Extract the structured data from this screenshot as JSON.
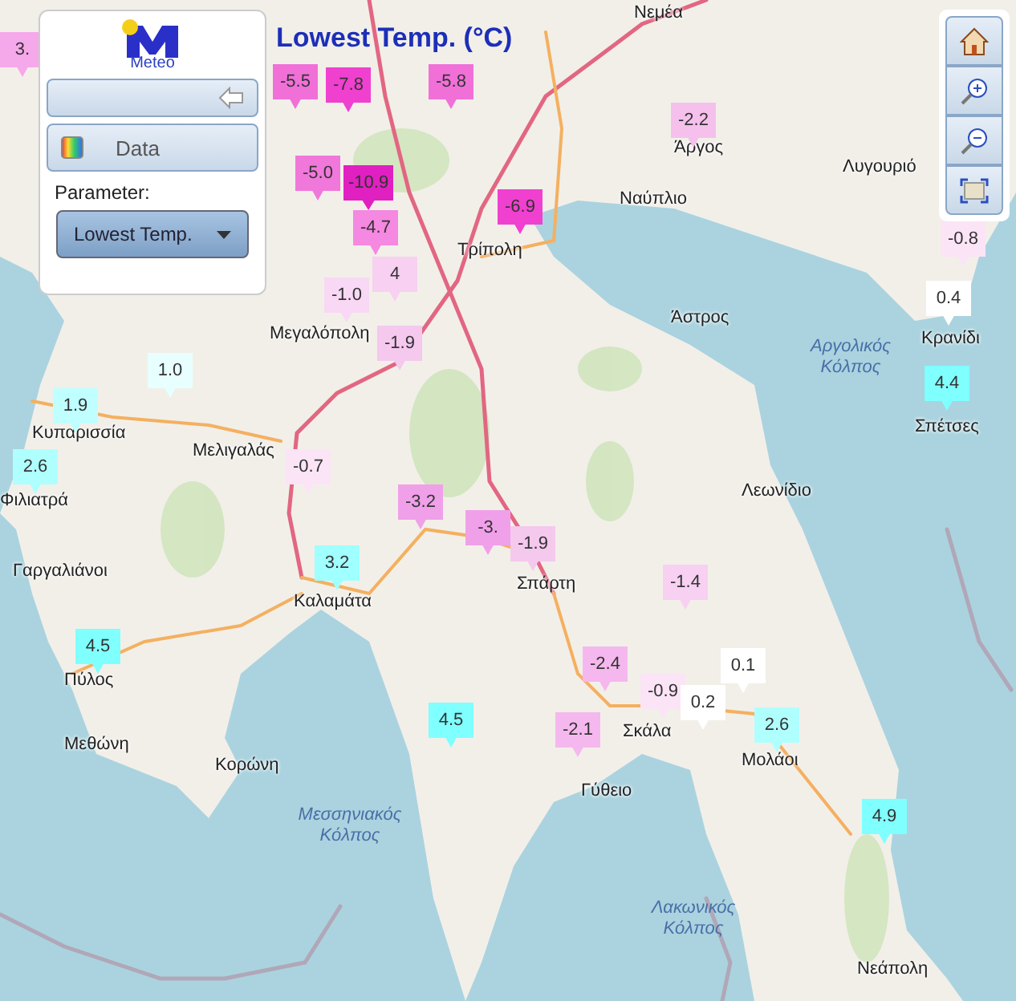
{
  "title": "Lowest Temp. (°C)",
  "panel": {
    "logo_text": "Meteo",
    "data_button": "Data",
    "parameter_label": "Parameter:",
    "parameter_value": "Lowest Temp."
  },
  "places": [
    {
      "name": "Νεμέα",
      "kind": "town"
    },
    {
      "name": "Άργος",
      "kind": "town"
    },
    {
      "name": "Ναύπλιο",
      "kind": "town"
    },
    {
      "name": "Λυγουριό",
      "kind": "town"
    },
    {
      "name": "Τρίπολη",
      "kind": "town"
    },
    {
      "name": "Μεγαλόπολη",
      "kind": "town"
    },
    {
      "name": "Άστρος",
      "kind": "town"
    },
    {
      "name": "Κρανίδι",
      "kind": "town"
    },
    {
      "name": "Αργολικός Κόλπος",
      "kind": "sea"
    },
    {
      "name": "Σπέτσες",
      "kind": "town"
    },
    {
      "name": "Κυπαρισσία",
      "kind": "town"
    },
    {
      "name": "Μελιγαλάς",
      "kind": "town"
    },
    {
      "name": "Φιλιατρά",
      "kind": "town"
    },
    {
      "name": "Λεωνίδιο",
      "kind": "town"
    },
    {
      "name": "Γαργαλιάνοι",
      "kind": "town"
    },
    {
      "name": "Σπάρτη",
      "kind": "town"
    },
    {
      "name": "Καλαμάτα",
      "kind": "town"
    },
    {
      "name": "Πύλος",
      "kind": "town"
    },
    {
      "name": "Σκάλα",
      "kind": "town"
    },
    {
      "name": "Μεθώνη",
      "kind": "town"
    },
    {
      "name": "Μολάοι",
      "kind": "town"
    },
    {
      "name": "Κορώνη",
      "kind": "town"
    },
    {
      "name": "Γύθειο",
      "kind": "town"
    },
    {
      "name": "Μεσσηνιακός Κόλπος",
      "kind": "sea"
    },
    {
      "name": "Λακωνικός Κόλπος",
      "kind": "sea"
    },
    {
      "name": "Νεάπολη",
      "kind": "town"
    }
  ],
  "markers": [
    {
      "value": "3.",
      "color": "#f5a8ea"
    },
    {
      "value": "-5.5",
      "color": "#f070d8"
    },
    {
      "value": "-7.8",
      "color": "#f040d0"
    },
    {
      "value": "-5.8",
      "color": "#f070d8"
    },
    {
      "value": "-5.0",
      "color": "#f078da"
    },
    {
      "value": "4",
      "color": "#f8d0f2"
    },
    {
      "value": "-10.9",
      "color": "#e020c0"
    },
    {
      "value": "-4.7",
      "color": "#f588e0"
    },
    {
      "value": "-1.0",
      "color": "#f8d8f4"
    },
    {
      "value": "-1.9",
      "color": "#f5c8ee"
    },
    {
      "value": "-6.9",
      "color": "#f040d0"
    },
    {
      "value": "-2.2",
      "color": "#f5c0ec"
    },
    {
      "value": "-0.8",
      "color": "#fbe4f6"
    },
    {
      "value": "0.4",
      "color": "#ffffff"
    },
    {
      "value": "4.4",
      "color": "#80ffff"
    },
    {
      "value": "1.0",
      "color": "#e8ffff"
    },
    {
      "value": "1.9",
      "color": "#c0ffff"
    },
    {
      "value": "2.6",
      "color": "#b0ffff"
    },
    {
      "value": "-0.7",
      "color": "#fbe4f6"
    },
    {
      "value": "-3.2",
      "color": "#f0a0e8"
    },
    {
      "value": "-3.",
      "color": "#f0a0e8"
    },
    {
      "value": "-1.9",
      "color": "#f5c8ee"
    },
    {
      "value": "3.2",
      "color": "#a0ffff"
    },
    {
      "value": "4.5",
      "color": "#80ffff"
    },
    {
      "value": "4.5",
      "color": "#80ffff"
    },
    {
      "value": "-1.4",
      "color": "#f8d0f2"
    },
    {
      "value": "-2.4",
      "color": "#f5b8ee"
    },
    {
      "value": "0.1",
      "color": "#ffffff"
    },
    {
      "value": "-0.9",
      "color": "#fbe4f6"
    },
    {
      "value": "0.2",
      "color": "#ffffff"
    },
    {
      "value": "-2.1",
      "color": "#f5b8ee"
    },
    {
      "value": "2.6",
      "color": "#b0ffff"
    },
    {
      "value": "4.9",
      "color": "#80ffff"
    }
  ]
}
